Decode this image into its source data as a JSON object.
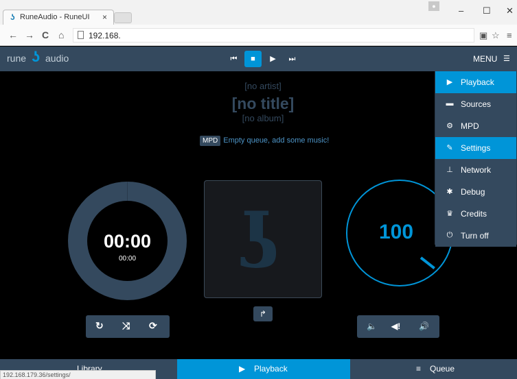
{
  "browser": {
    "tab_title": "RuneAudio - RuneUI",
    "tab_close": "×",
    "url": "192.168.",
    "status_url": "192.168.179.36/settings/"
  },
  "app": {
    "logo_word1": "rune",
    "logo_word2": "audio",
    "menu_label": "MENU"
  },
  "track": {
    "artist": "[no artist]",
    "title": "[no title]",
    "album": "[no album]",
    "source_badge": "MPD",
    "queue_note": "Empty queue, add some music!",
    "elapsed": "00:00",
    "total": "00:00",
    "volume": "100"
  },
  "menu": {
    "items": [
      {
        "label": "Playback",
        "icon": "play-icon",
        "active": true
      },
      {
        "label": "Sources",
        "icon": "folder-icon",
        "active": false
      },
      {
        "label": "MPD",
        "icon": "cogs-icon",
        "active": false
      },
      {
        "label": "Settings",
        "icon": "wrench-icon",
        "active": true
      },
      {
        "label": "Network",
        "icon": "sitemap-icon",
        "active": false
      },
      {
        "label": "Debug",
        "icon": "bug-icon",
        "active": false
      },
      {
        "label": "Credits",
        "icon": "trophy-icon",
        "active": false
      },
      {
        "label": "Turn off",
        "icon": "power-icon",
        "active": false
      }
    ]
  },
  "bottom_nav": {
    "library": "Library",
    "playback": "Playback",
    "queue": "Queue"
  },
  "colors": {
    "accent": "#0095d8",
    "panel": "#34495e"
  }
}
